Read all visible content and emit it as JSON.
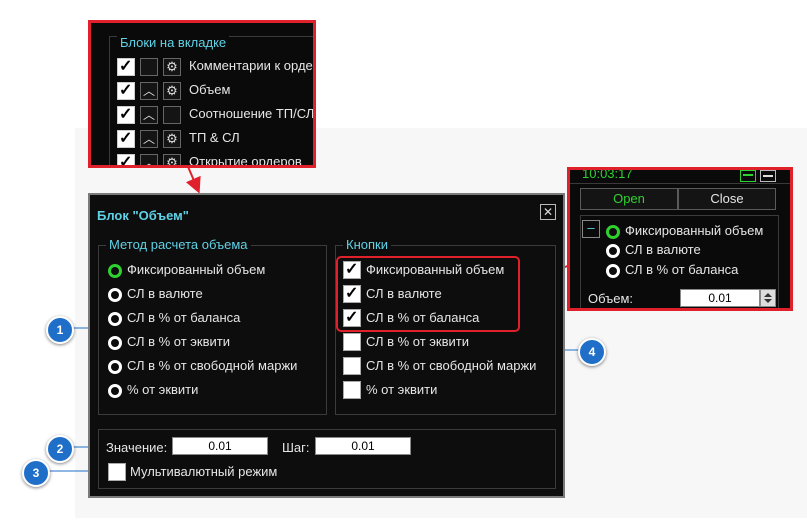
{
  "inset": {
    "group_title": "Блоки на вкладке",
    "rows": [
      {
        "label": "Комментарии к орде",
        "checked": true
      },
      {
        "label": "Объем",
        "checked": true
      },
      {
        "label": "Соотношение ТП/СЛ",
        "checked": true
      },
      {
        "label": "ТП & СЛ",
        "checked": true
      },
      {
        "label": "Открытие ордеров",
        "checked": true
      }
    ]
  },
  "dialog": {
    "title": "Блок \"Объем\"",
    "close_glyph": "✕",
    "method_group": {
      "title": "Метод расчета объема",
      "options": [
        "Фиксированный объем",
        "СЛ в валюте",
        "СЛ в % от баланса",
        "СЛ в % от эквити",
        "СЛ в % от свободной маржи",
        "% от эквити"
      ],
      "selected": 0
    },
    "buttons_group": {
      "title": "Кнопки",
      "items": [
        {
          "label": "Фиксированный объем",
          "checked": true
        },
        {
          "label": "СЛ в валюте",
          "checked": true
        },
        {
          "label": "СЛ в % от баланса",
          "checked": true
        },
        {
          "label": "СЛ в % от эквити",
          "checked": false
        },
        {
          "label": "СЛ в % от свободной маржи",
          "checked": false
        },
        {
          "label": "% от эквити",
          "checked": false
        }
      ]
    },
    "value_label": "Значение:",
    "value": "0.01",
    "step_label": "Шаг:",
    "step": "0.01",
    "multicurrency_label": "Мультивалютный режим"
  },
  "panel": {
    "time": "10:03:17",
    "open_label": "Open",
    "close_label": "Close",
    "collapse_glyph": "–",
    "options": [
      "Фиксированный объем",
      "СЛ в валюте",
      "СЛ в % от баланса"
    ],
    "selected": 0,
    "volume_label": "Объем:",
    "volume_value": "0.01"
  },
  "callouts": [
    "1",
    "2",
    "3",
    "4"
  ],
  "colors": {
    "accent_cyan": "#5fd2e6",
    "highlight_red": "#e0202a",
    "radio_green": "#2ed12e",
    "callout_blue": "#1f6fc9",
    "open_green": "#2ed12e"
  }
}
